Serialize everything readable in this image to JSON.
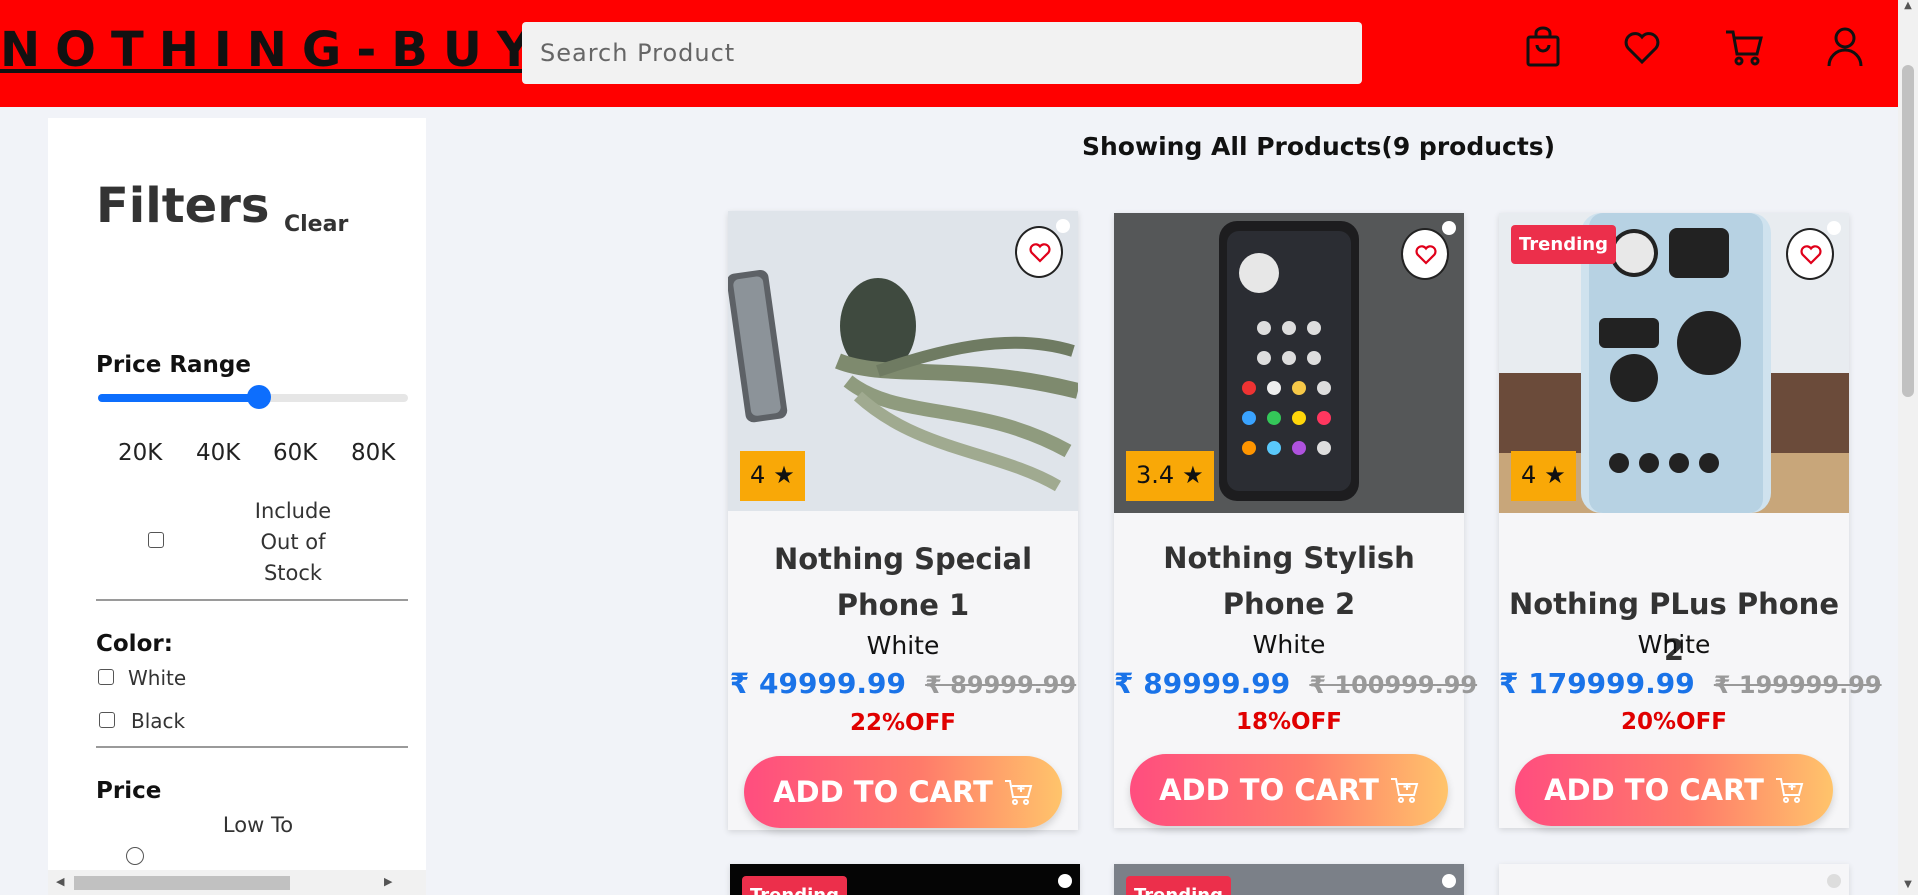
{
  "header": {
    "logo": "NOTHING-BUY",
    "search_placeholder": "Search Product",
    "icons": [
      "bag-icon",
      "heart-icon",
      "cart-icon",
      "user-icon"
    ]
  },
  "sidebar": {
    "title": "Filters",
    "clear_label": "Clear",
    "price_range": {
      "label": "Price Range",
      "ticks": [
        "20K",
        "40K",
        "60K",
        "80K"
      ],
      "slider_level": 0.52
    },
    "include_out_of_stock": {
      "label": "Include Out of Stock",
      "checked": false
    },
    "color": {
      "label": "Color:",
      "options": [
        {
          "label": "White",
          "checked": false
        },
        {
          "label": "Black",
          "checked": false
        }
      ]
    },
    "price_sort": {
      "label": "Price",
      "option_partial": "Low To"
    }
  },
  "main": {
    "showing_text": "Showing All Products(9 products)",
    "products": [
      {
        "title": "Nothing Special Phone 1",
        "color": "White",
        "price": "₹ 49999.99",
        "mrp": "₹ 89999.99",
        "discount": "22%OFF",
        "rating": "4",
        "trending": false,
        "cart_label": "ADD TO CART"
      },
      {
        "title": "Nothing Stylish Phone 2",
        "color": "White",
        "price": "₹ 89999.99",
        "mrp": "₹ 100999.99",
        "discount": "18%OFF",
        "rating": "3.4",
        "trending": false,
        "cart_label": "ADD TO CART"
      },
      {
        "title": "Nothing PLus Phone 2",
        "color": "White",
        "price": "₹ 179999.99",
        "mrp": "₹ 199999.99",
        "discount": "20%OFF",
        "rating": "4",
        "trending": true,
        "trending_label": "Trending",
        "cart_label": "ADD TO CART"
      }
    ],
    "second_row_badges": [
      "Trending",
      "Trending"
    ]
  },
  "colors": {
    "header_bg": "#ff0000",
    "accent_blue": "#1a73e8",
    "discount_red": "#e00000",
    "rating_bg": "#f9a807",
    "trending_bg": "#ec2f4b"
  }
}
